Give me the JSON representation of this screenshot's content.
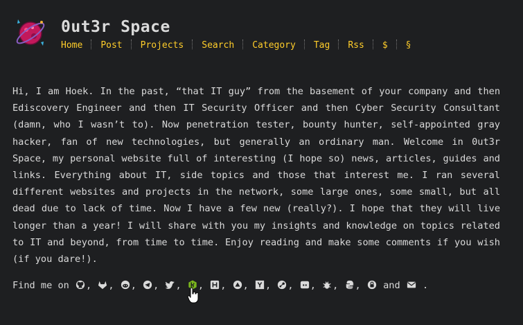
{
  "site": {
    "title": "0ut3r Space"
  },
  "nav": {
    "items": [
      "Home",
      "Post",
      "Projects",
      "Search",
      "Category",
      "Tag",
      "Rss",
      "$",
      "§"
    ]
  },
  "bio": {
    "text": "Hi, I am Hoek. In the past, “that IT guy” from the basement of your company and then Ediscovery Engineer and then IT Security Officer and then Cyber Security Consultant (damn, who I wasn’t to). Now penetration tester, bounty hunter, self-appointed gray hacker, fan of new technologies, but generally an ordinary man. Welcome in 0ut3r Space, my personal website full of interesting (I hope so) news, articles, guides and links. Everything about IT, side topics and those that interest me. I ran several different websites and projects in the network, some large ones, some small, but all dead due to lack of time. Now I have a few new (really?). I hope that they will live longer than a year! I will share with you my insights and knowledge on topics related to IT and beyond, from time to time. Enjoy reading and make some comments if you wish (if you dare!)."
  },
  "find": {
    "prefix": "Find me on",
    "conjunction": "and",
    "end": ".",
    "icons": [
      "github-icon",
      "gitlab-icon",
      "reddit-icon",
      "telegram-icon",
      "twitter-icon",
      "hackerone-icon",
      "hackerone-h-icon",
      "hackthebox-icon",
      "ycombinator-icon",
      "steam-icon",
      "discord-icon",
      "bug-icon",
      "python-icon",
      "keybase-icon"
    ],
    "last_icon": "email-icon"
  },
  "colors": {
    "background": "#1e1f21",
    "text": "#dadada",
    "nav_link": "#ffcd2a",
    "active_icon": "#7ab51d"
  }
}
